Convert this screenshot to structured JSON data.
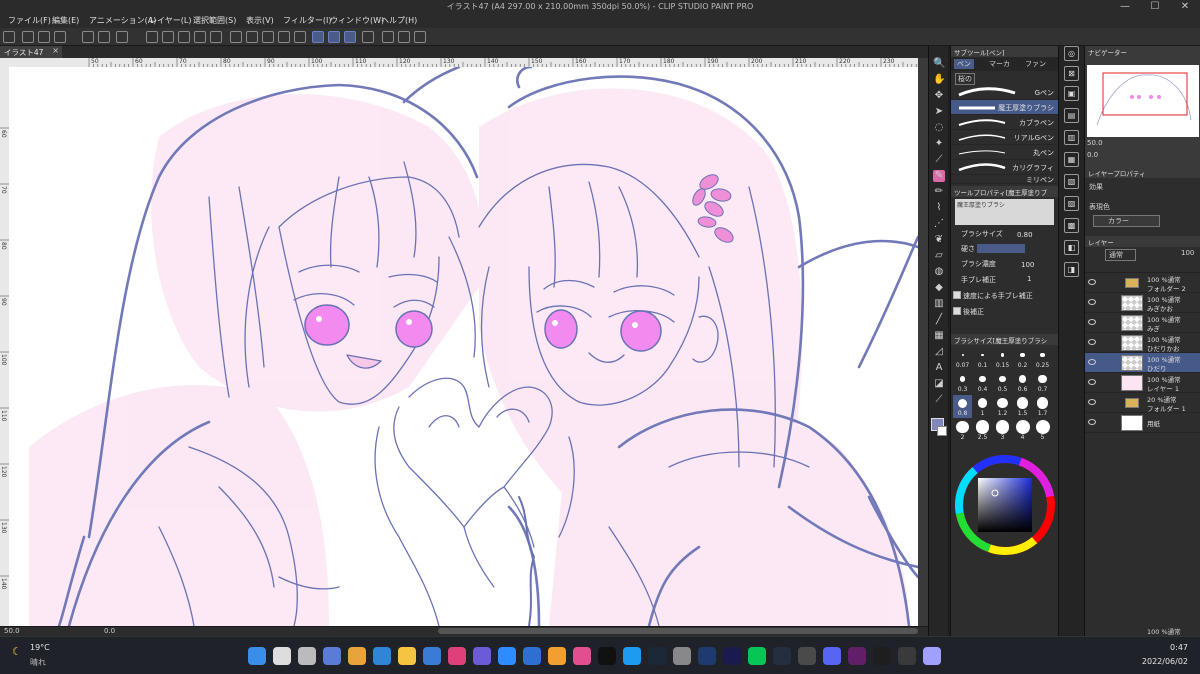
{
  "window": {
    "title": "イラスト47 (A4 297.00 x 210.00mm 350dpi 50.0%) - CLIP STUDIO PAINT PRO",
    "minimize": "—",
    "maximize": "☐",
    "close": "✕"
  },
  "menu": [
    "ファイル(F)",
    "編集(E)",
    "アニメーション(A)",
    "レイヤー(L)",
    "選択範囲(S)",
    "表示(V)",
    "フィルター(I)",
    "ウィンドウ(W)",
    "ヘルプ(H)"
  ],
  "tab": {
    "label": "イラスト47",
    "close": "×"
  },
  "rulers": {
    "h": [
      "50",
      "60",
      "70",
      "80",
      "90",
      "100",
      "110",
      "120",
      "130",
      "140",
      "150",
      "160",
      "170",
      "180",
      "190",
      "200",
      "210",
      "220",
      "230",
      "240"
    ],
    "v": [
      "60",
      "70",
      "80",
      "90",
      "100",
      "110",
      "120",
      "130",
      "140"
    ]
  },
  "status": {
    "zoom": "50.0",
    "angle": "0.0"
  },
  "subtool": {
    "header": "サブツール[ペン]",
    "tabs": [
      "ペン",
      "マーカ",
      "ファン"
    ],
    "brushes": [
      "Gペン",
      "魔王厚塗りブラシ",
      "カブラペン",
      "リアルGペン",
      "丸ペン",
      "カリグラフィ",
      "ミリペン"
    ],
    "selected_brush": "魔王厚塗りブラシ",
    "group_label": "桜の"
  },
  "toolprop": {
    "header": "ツールプロパティ[魔王厚塗りブ",
    "preview_label": "魔王厚塗りブラシ",
    "brush_size_label": "ブラシサイズ",
    "brush_size": "0.80",
    "hardness_label": "硬さ",
    "density_label": "ブラシ濃度",
    "density": "100",
    "stabilize_label": "手ブレ補正",
    "stabilize": "1",
    "speed_label": "速度による手ブレ補正",
    "post_label": "後補正"
  },
  "brushsize": {
    "header": "ブラシサイズ[魔王厚塗りブラシ",
    "sizes": [
      "0.07",
      "0.1",
      "0.15",
      "0.2",
      "0.25",
      "0.3",
      "0.4",
      "0.5",
      "0.6",
      "0.7",
      "0.8",
      "1",
      "1.2",
      "1.5",
      "1.7",
      "2",
      "2.5",
      "3",
      "4",
      "5"
    ]
  },
  "color": {
    "r": "127",
    "g": "136",
    "b": "189",
    "main": "#7f88bd"
  },
  "navigator": {
    "header": "ナビゲーター",
    "zoom": "50.0",
    "angle": "0.0"
  },
  "layerprop": {
    "header": "レイヤープロパティ",
    "effect_label": "効果",
    "expression_label": "表現色",
    "expression_value": "カラー"
  },
  "layers": {
    "header": "レイヤー",
    "blend": "通常",
    "opacity": "100",
    "items": [
      {
        "l1": "100 %通常",
        "l2": "フォルダー 2",
        "kind": "folder"
      },
      {
        "l1": "100 %通常",
        "l2": "みぎかお",
        "kind": "check"
      },
      {
        "l1": "100 %通常",
        "l2": "みぎ",
        "kind": "check"
      },
      {
        "l1": "100 %通常",
        "l2": "ひだりかお",
        "kind": "check"
      },
      {
        "l1": "100 %通常",
        "l2": "ひだり",
        "kind": "check"
      },
      {
        "l1": "100 %通常",
        "l2": "レイヤー 1",
        "kind": "pink"
      },
      {
        "l1": "20 %通常",
        "l2": "フォルダー 1",
        "kind": "folder"
      },
      {
        "l1": "",
        "l2": "用紙",
        "kind": "white"
      }
    ],
    "bottom": {
      "l1": "100 %通常",
      "l2": "フォルダー 1"
    },
    "selected": 4
  },
  "taskbar": {
    "weather_temp": "19°C",
    "weather_text": "晴れ",
    "time": "0:47",
    "date": "2022/06/02",
    "icons": [
      "start-icon",
      "search-icon",
      "task-view-icon",
      "widgets-icon",
      "chrome-icon",
      "edge-icon",
      "explorer-icon",
      "store-icon",
      "music-icon",
      "photos-icon",
      "zoom-icon",
      "onedrive-icon",
      "capture-icon",
      "clip-studio-icon",
      "line-icon",
      "twitter-icon",
      "steam-icon",
      "paint-icon",
      "ps-icon",
      "ae-icon",
      "line-app-icon",
      "amazon-icon",
      "music2-icon",
      "discord-icon",
      "slack-icon",
      "app-icon",
      "chat-icon",
      "clip-icon"
    ]
  }
}
